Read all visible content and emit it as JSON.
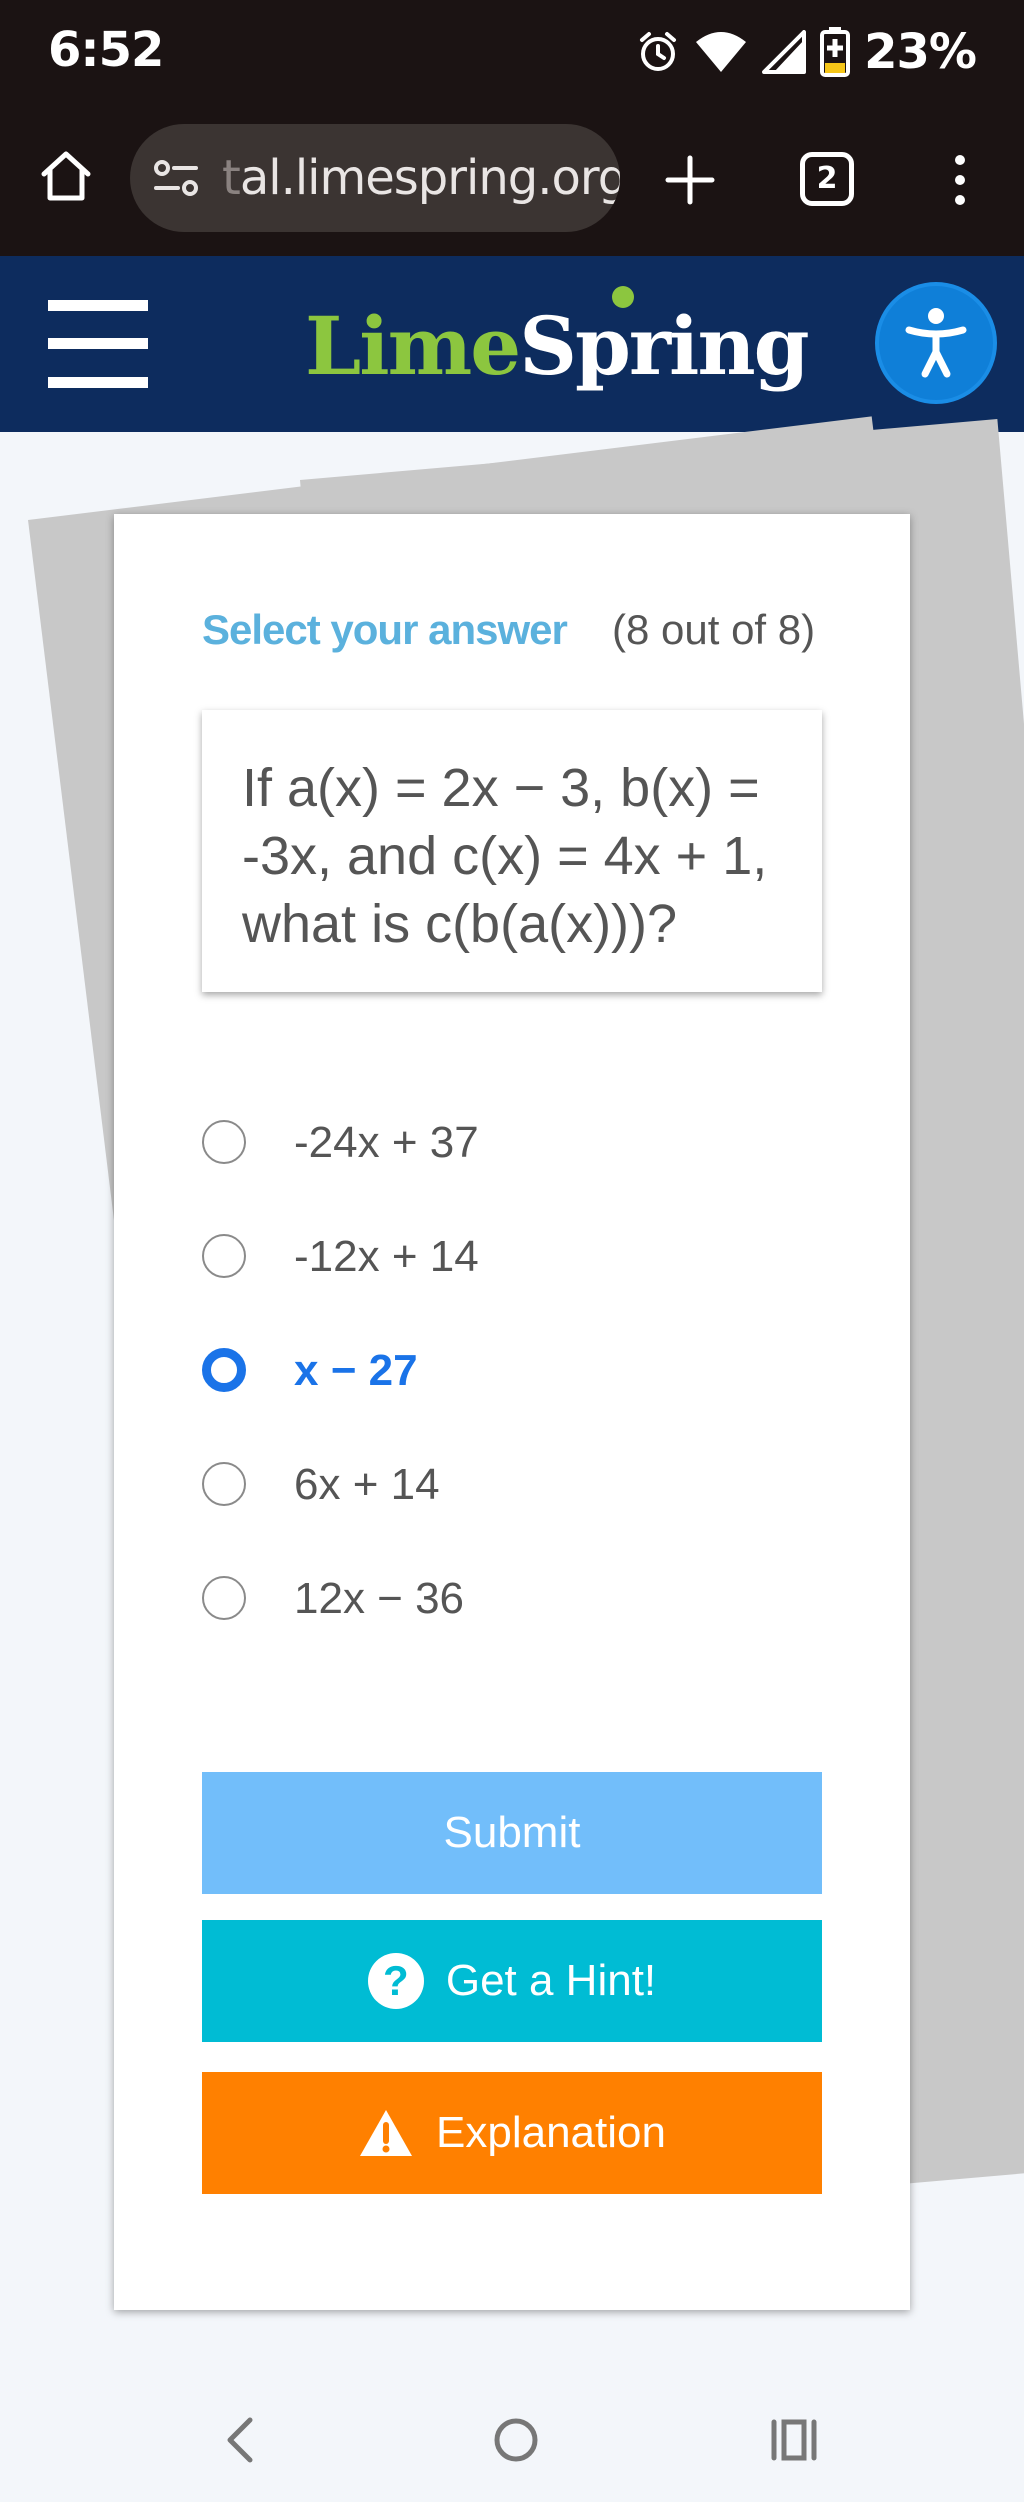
{
  "status_bar": {
    "time": "6:52",
    "battery": "23%",
    "icons": [
      "alarm-icon",
      "wifi-icon",
      "signal-icon",
      "battery-charging-icon"
    ]
  },
  "browser": {
    "url_faded": "t",
    "url_visible": "al.limespring.org",
    "tab_count": "2"
  },
  "site": {
    "logo_lime": "Lime",
    "logo_spring": "Spring",
    "accent_green": "#8cc63f",
    "header_color": "#0d2c5e"
  },
  "quiz": {
    "select_label": "Select your answer",
    "progress": "(8 out of 8)",
    "question": "If a(x) = 2x − 3, b(x) = -3x, and c(x) = 4x + 1, what is c(b(a(x)))?",
    "choices": [
      {
        "label": "-24x + 37",
        "selected": false
      },
      {
        "label": "-12x + 14",
        "selected": false
      },
      {
        "label": "x − 27",
        "selected": true
      },
      {
        "label": "6x + 14",
        "selected": false
      },
      {
        "label": "12x − 36",
        "selected": false
      }
    ],
    "submit_label": "Submit",
    "hint_label": "Get a Hint!",
    "explanation_label": "Explanation",
    "colors": {
      "submit": "#72befa",
      "hint": "#00bcd4",
      "explanation": "#ff8000",
      "selected": "#1a73e8"
    }
  }
}
